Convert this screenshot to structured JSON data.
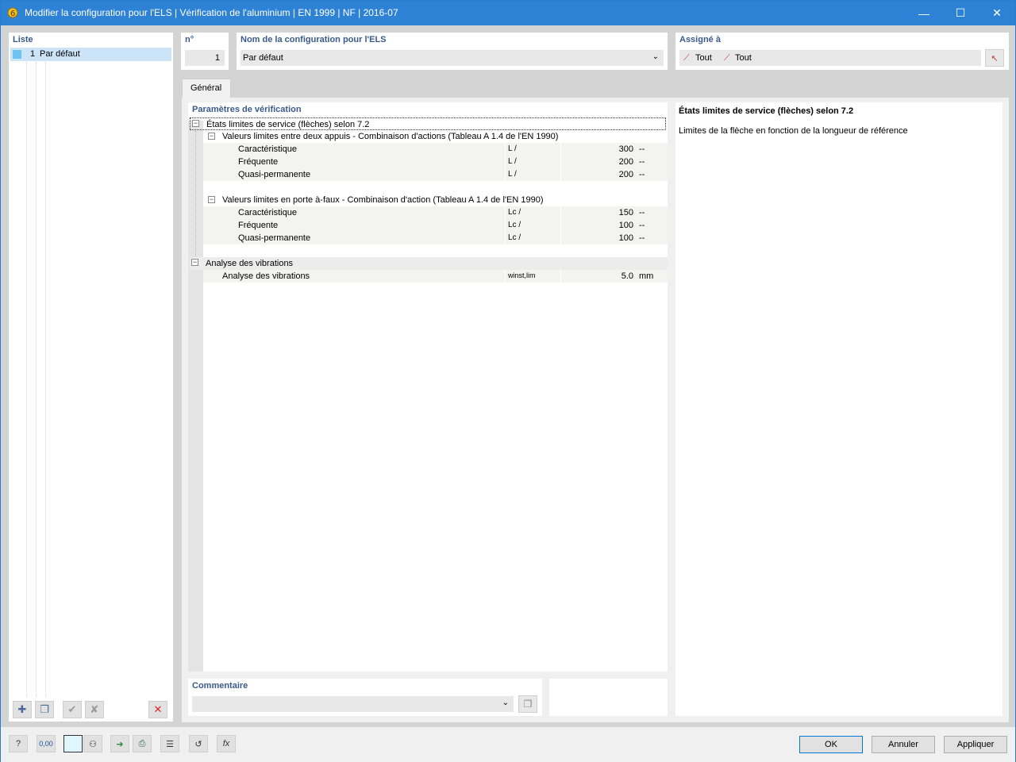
{
  "window": {
    "title": "Modifier la configuration pour l'ELS | Vérification de l'aluminium | EN 1999 | NF | 2016-07",
    "minimize": "—",
    "maximize": "☐",
    "close": "✕"
  },
  "list": {
    "header": "Liste",
    "items": [
      {
        "num": "1",
        "label": "Par défaut",
        "color": "#6fc3f3"
      }
    ]
  },
  "config": {
    "num_header": "n°",
    "num_value": "1",
    "name_header": "Nom de la configuration pour l'ELS",
    "name_value": "Par défaut",
    "assigned_header": "Assigné à",
    "assigned_1": "Tout",
    "assigned_2": "Tout"
  },
  "tabs": [
    {
      "label": "Général",
      "active": true
    }
  ],
  "tree": {
    "header": "Paramètres de vérification",
    "group1": {
      "title": "États limites de service (flèches) selon 7.2",
      "sub1": {
        "title": "Valeurs limites entre deux appuis - Combinaison d'actions (Tableau A 1.4 de l'EN 1990)",
        "rows": [
          {
            "label": "Caractéristique",
            "symbol": "L /",
            "value": "300",
            "unit": "--"
          },
          {
            "label": "Fréquente",
            "symbol": "L /",
            "value": "200",
            "unit": "--"
          },
          {
            "label": "Quasi-permanente",
            "symbol": "L /",
            "value": "200",
            "unit": "--"
          }
        ]
      },
      "sub2": {
        "title": "Valeurs limites en porte à-faux - Combinaison d'action (Tableau A 1.4 de l'EN 1990)",
        "rows": [
          {
            "label": "Caractéristique",
            "symbol": "Lc /",
            "value": "150",
            "unit": "--"
          },
          {
            "label": "Fréquente",
            "symbol": "Lc /",
            "value": "100",
            "unit": "--"
          },
          {
            "label": "Quasi-permanente",
            "symbol": "Lc /",
            "value": "100",
            "unit": "--"
          }
        ]
      }
    },
    "group2": {
      "title": "Analyse des vibrations",
      "rows": [
        {
          "label": "Analyse des vibrations",
          "symbol": "winst,lim",
          "value": "5.0",
          "unit": "mm"
        }
      ]
    }
  },
  "description": {
    "title": "États limites de service (flèches) selon 7.2",
    "text": "Limites de la flèche en fonction de la longueur de référence"
  },
  "comment": {
    "header": "Commentaire",
    "value": ""
  },
  "buttons": {
    "ok": "OK",
    "cancel": "Annuler",
    "apply": "Appliquer"
  },
  "bottom_icons": [
    "help-icon",
    "units-icon",
    "color-icon",
    "display-icon",
    "export-icon",
    "print-icon",
    "library-icon",
    "reset-icon",
    "formula-icon"
  ],
  "units_icon_text": "0,00"
}
